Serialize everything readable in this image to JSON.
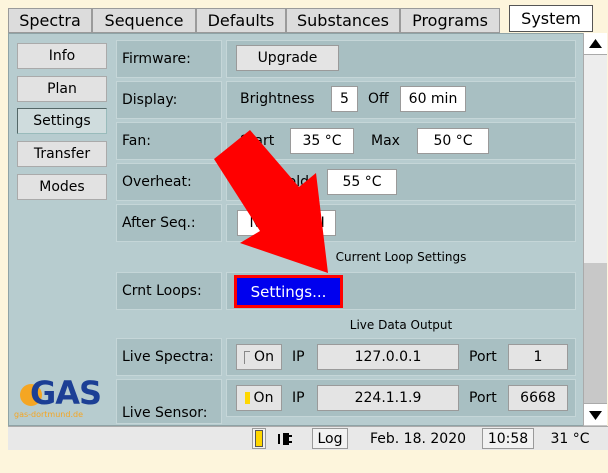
{
  "tabs": [
    "Spectra",
    "Sequence",
    "Defaults",
    "Substances",
    "Programs",
    "System"
  ],
  "nav": [
    "Info",
    "Plan",
    "Settings",
    "Transfer",
    "Modes"
  ],
  "rows": {
    "firmware": {
      "label": "Firmware:",
      "button": "Upgrade"
    },
    "display": {
      "label": "Display:",
      "brightness_label": "Brightness",
      "brightness_value": "5",
      "off_label": "Off",
      "off_value": "60 min"
    },
    "fan": {
      "label": "Fan:",
      "start_label": "Start",
      "start_value": "35 °C",
      "max_label": "Max",
      "max_value": "50 °C"
    },
    "overheat": {
      "label": "Overheat:",
      "threshold_label": "Threshold",
      "threshold_value": "55 °C"
    },
    "after_seq": {
      "label": "After Seq.:",
      "option_a": "No",
      "option_b": "ON"
    },
    "current_loop_header": "Current Loop Settings",
    "crnt_loops": {
      "label": "Crnt Loops:",
      "button": "Settings..."
    },
    "live_data_header": "Live Data Output",
    "live_spectra": {
      "label": "Live Spectra:",
      "on_label": "On",
      "ip_label": "IP",
      "ip_value": "127.0.0.1",
      "port_label": "Port",
      "port_value": "1"
    },
    "live_sensor": {
      "label": "Live Sensor:",
      "on_label": "On",
      "ip_label": "IP",
      "ip_value": "224.1.1.9",
      "port_label": "Port",
      "port_value": "6668"
    }
  },
  "logo": {
    "text": "GAS",
    "subtext": "gas-dortmund.de"
  },
  "status": {
    "log": "Log",
    "date": "Feb. 18. 2020",
    "time": "10:58",
    "temp": "31 °C"
  },
  "colors": {
    "accent_button": "#0000ee",
    "highlight_border": "#ff0000",
    "arrow": "#ff0000",
    "logo_orange": "#f5a623",
    "logo_blue": "#1c3f95",
    "panel": "#b7cccf"
  },
  "icons": {
    "scroll_up": "triangle-up",
    "scroll_down": "triangle-down",
    "annotation": "red-arrow",
    "battery": "yellow-bar",
    "plug": "plug"
  }
}
